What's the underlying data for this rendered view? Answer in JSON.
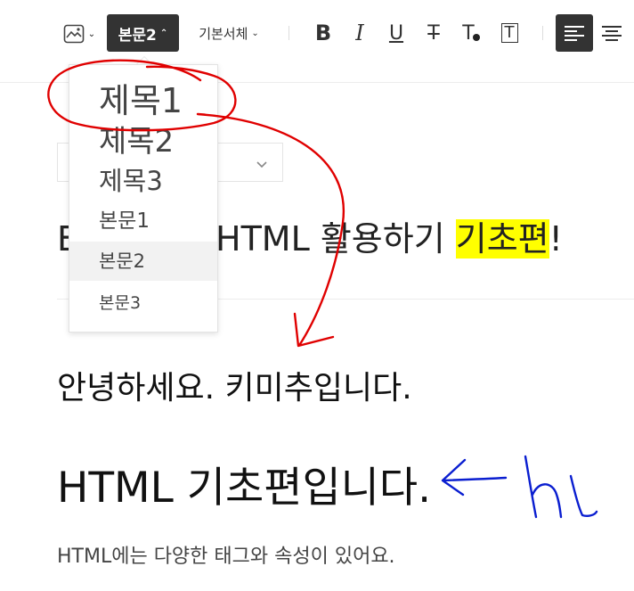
{
  "toolbar": {
    "image_icon": "image-icon",
    "style_label": "본문2",
    "font_label": "기본서체",
    "format_icons": [
      "bold-icon",
      "italic-icon",
      "underline-icon",
      "strikethrough-icon",
      "text-color-icon",
      "text-background-icon"
    ],
    "bold": "B",
    "italic": "I",
    "underline": "U",
    "strike": "T",
    "color": "T",
    "bg": "T"
  },
  "style_menu": {
    "items": [
      {
        "label": "제목1"
      },
      {
        "label": "제목2"
      },
      {
        "label": "제목3"
      },
      {
        "label": "본문1"
      },
      {
        "label": "본문2",
        "selected": true
      },
      {
        "label": "본문3"
      }
    ]
  },
  "editor": {
    "title_prefix": "E",
    "title_main": "HTML 활용하기 ",
    "title_highlight": "기초편",
    "title_suffix": "!",
    "greeting": "안녕하세요. 키미추입니다.",
    "heading1": "HTML 기초편입니다.",
    "paragraph": "HTML에는 다양한 태그와 속성이 있어요."
  },
  "colors": {
    "toolbar_active": "#333333",
    "highlight": "#ffff00",
    "annotation_red": "#e00000",
    "annotation_blue": "#0a1ed0"
  }
}
